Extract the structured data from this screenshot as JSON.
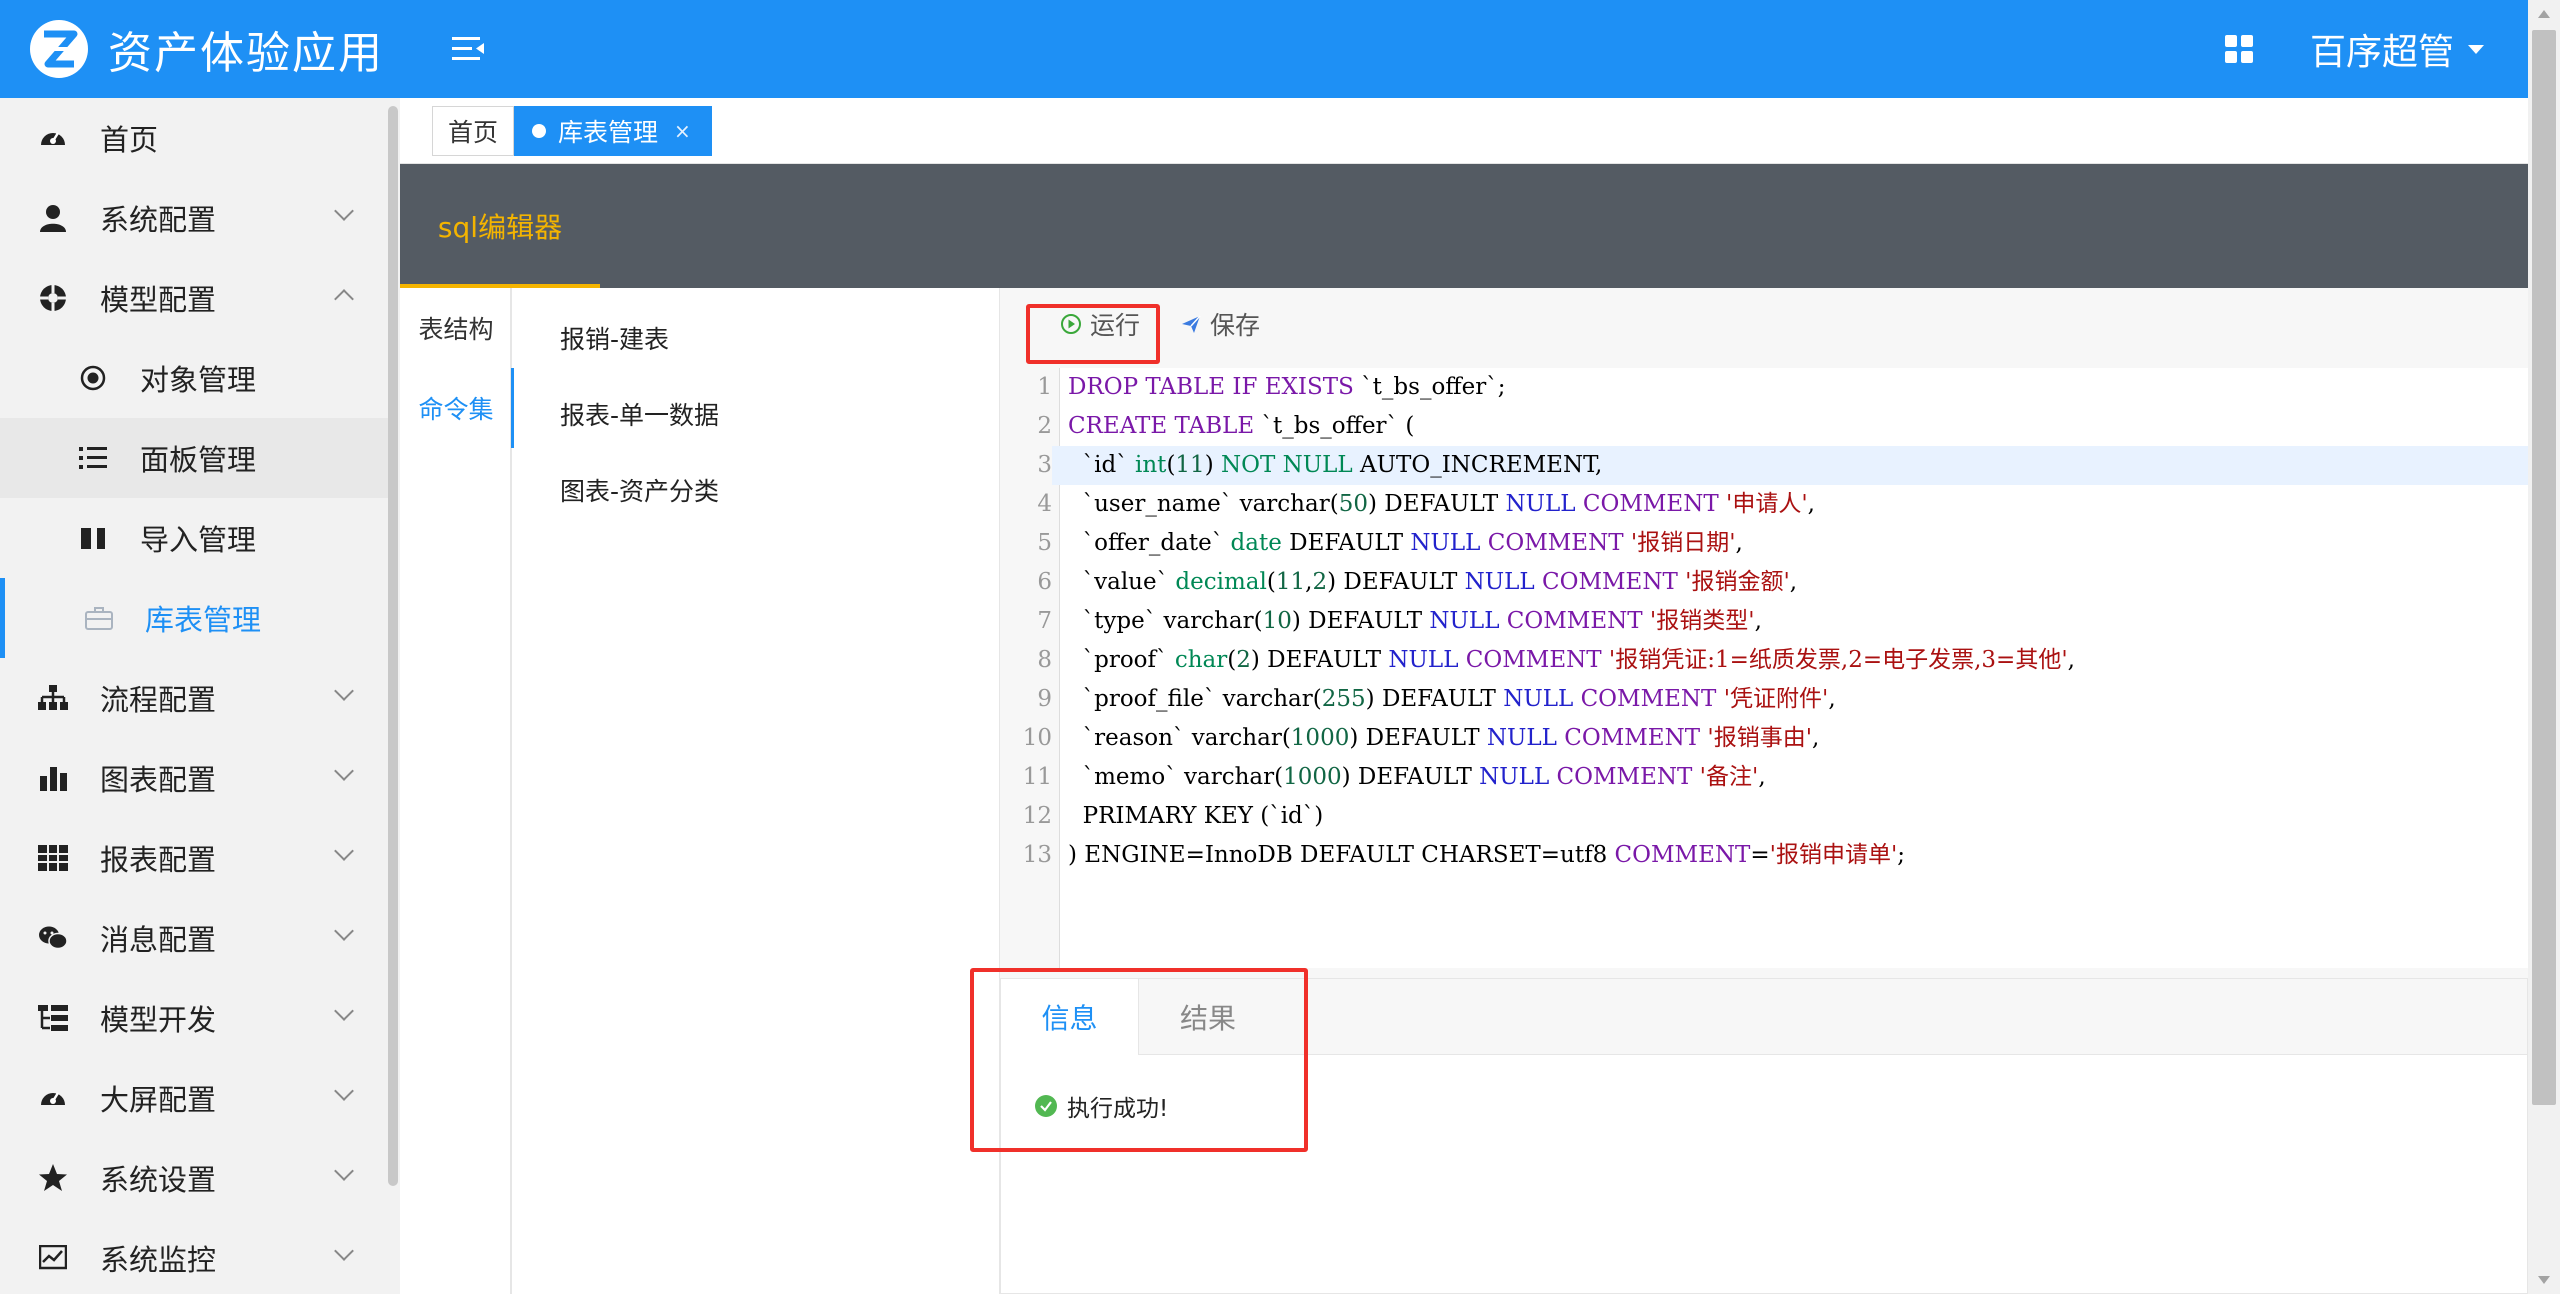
{
  "header": {
    "app_title": "资产体验应用",
    "user_name": "百序超管",
    "brand_color": "#1e90f5"
  },
  "sidebar": {
    "items": [
      {
        "label": "首页",
        "icon": "dashboard-icon"
      },
      {
        "label": "系统配置",
        "icon": "user-icon"
      },
      {
        "label": "模型配置",
        "icon": "model-icon"
      },
      {
        "label": "对象管理",
        "icon": "radio-icon"
      },
      {
        "label": "面板管理",
        "icon": "list-icon"
      },
      {
        "label": "导入管理",
        "icon": "book-icon"
      },
      {
        "label": "库表管理",
        "icon": "briefcase-icon"
      },
      {
        "label": "流程配置",
        "icon": "sitemap-icon"
      },
      {
        "label": "图表配置",
        "icon": "bar-chart-icon"
      },
      {
        "label": "报表配置",
        "icon": "table-icon"
      },
      {
        "label": "消息配置",
        "icon": "wechat-icon"
      },
      {
        "label": "模型开发",
        "icon": "tree-icon"
      },
      {
        "label": "大屏配置",
        "icon": "dashboard-icon"
      },
      {
        "label": "系统设置",
        "icon": "star-icon"
      },
      {
        "label": "系统监控",
        "icon": "monitor-icon"
      }
    ]
  },
  "tabs": {
    "home": "首页",
    "current": "库表管理",
    "close": "×"
  },
  "panel": {
    "title": "sql编辑器"
  },
  "vtabs": {
    "structure": "表结构",
    "commands": "命令集"
  },
  "commands": [
    "报销-建表",
    "报表-单一数据",
    "图表-资产分类"
  ],
  "toolbar": {
    "run": "运行",
    "save": "保存"
  },
  "code": {
    "lines": [
      "DROP TABLE IF EXISTS `t_bs_offer`;",
      "CREATE TABLE `t_bs_offer` (",
      "  `id` int(11) NOT NULL AUTO_INCREMENT,",
      "  `user_name` varchar(50) DEFAULT NULL COMMENT '申请人',",
      "  `offer_date` date DEFAULT NULL COMMENT '报销日期',",
      "  `value` decimal(11,2) DEFAULT NULL COMMENT '报销金额',",
      "  `type` varchar(10) DEFAULT NULL COMMENT '报销类型',",
      "  `proof` char(2) DEFAULT NULL COMMENT '报销凭证:1=纸质发票,2=电子发票,3=其他',",
      "  `proof_file` varchar(255) DEFAULT NULL COMMENT '凭证附件',",
      "  `reason` varchar(1000) DEFAULT NULL COMMENT '报销事由',",
      "  `memo` varchar(1000) DEFAULT NULL COMMENT '备注',",
      "  PRIMARY KEY (`id`)",
      ") ENGINE=InnoDB DEFAULT CHARSET=utf8 COMMENT='报销申请单';"
    ]
  },
  "result": {
    "tab_info": "信息",
    "tab_result": "结果",
    "message": "执行成功!"
  }
}
